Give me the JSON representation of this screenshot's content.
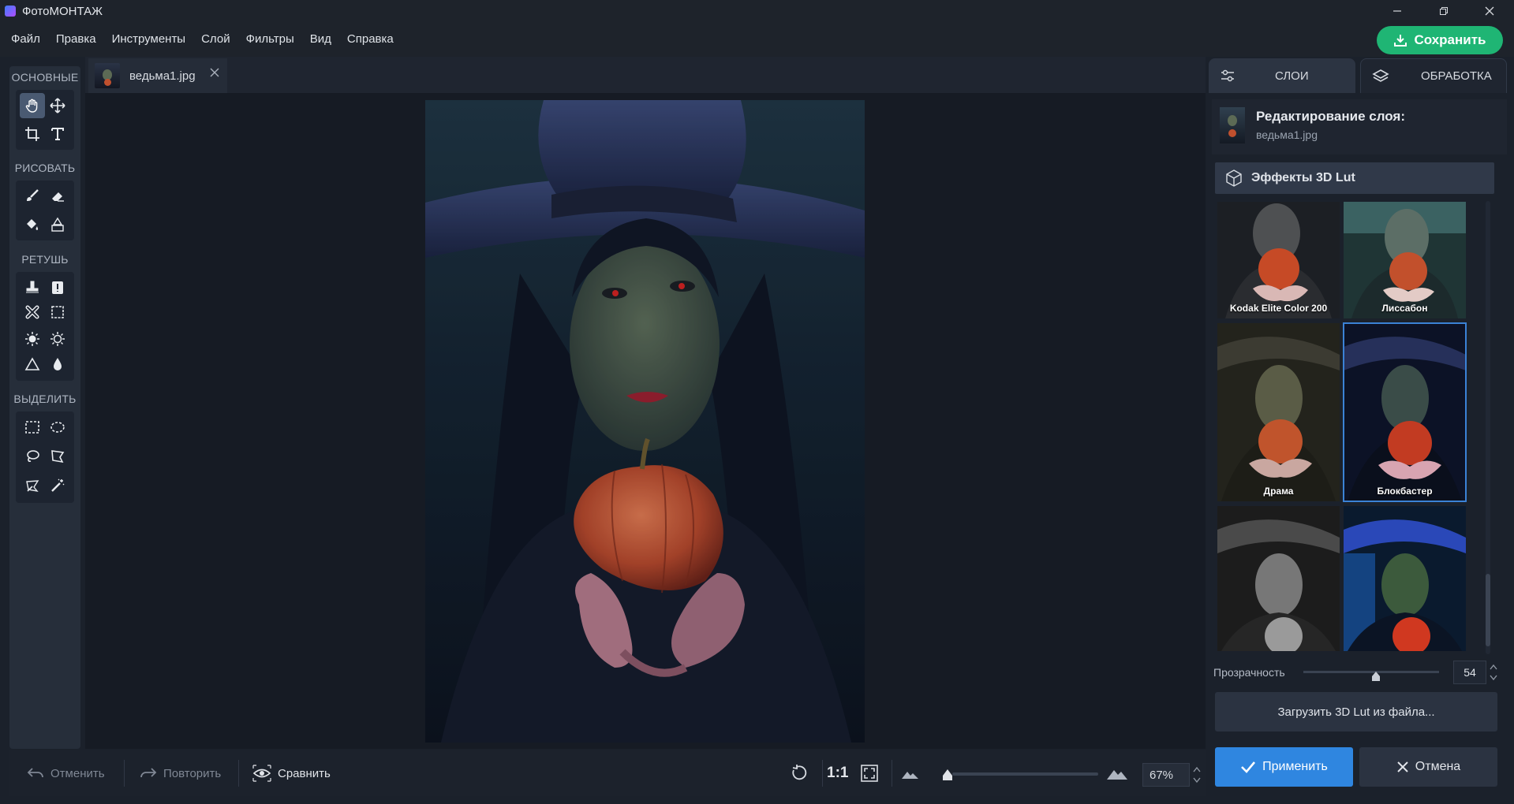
{
  "app": {
    "title": "ФотоМОНТАЖ"
  },
  "menu": [
    "Файл",
    "Правка",
    "Инструменты",
    "Слой",
    "Фильтры",
    "Вид",
    "Справка"
  ],
  "toolbar": {
    "save_label": "Сохранить"
  },
  "tools": {
    "section_main": "ОСНОВНЫЕ",
    "section_draw": "РИСОВАТЬ",
    "section_retouch": "РЕТУШЬ",
    "section_select": "ВЫДЕЛИТЬ"
  },
  "document": {
    "tab_name": "ведьма1.jpg"
  },
  "statusbar": {
    "undo_label": "Отменить",
    "redo_label": "Повторить",
    "compare_label": "Сравнить",
    "actual_size_label": "1:1",
    "zoom_value": "67%"
  },
  "panel": {
    "tab_layers": "СЛОИ",
    "tab_processing": "ОБРАБОТКА",
    "layer_heading": "Редактирование слоя:",
    "layer_file": "ведьма1.jpg",
    "effects_title": "Эффекты 3D Lut",
    "presets": [
      {
        "label": "Kodak Elite Color 200"
      },
      {
        "label": "Лиссабон"
      },
      {
        "label": "Драма"
      },
      {
        "label": "Блокбастер",
        "selected": true
      },
      {
        "label": ""
      },
      {
        "label": ""
      }
    ],
    "opacity_label": "Прозрачность",
    "opacity_value": "54",
    "load_button": "Загрузить 3D Lut из файла...",
    "apply_button": "Применить",
    "cancel_button": "Отмена"
  },
  "colors": {
    "accent_green": "#1fb574",
    "accent_blue": "#2f86e0",
    "selection": "#3b82d6"
  }
}
